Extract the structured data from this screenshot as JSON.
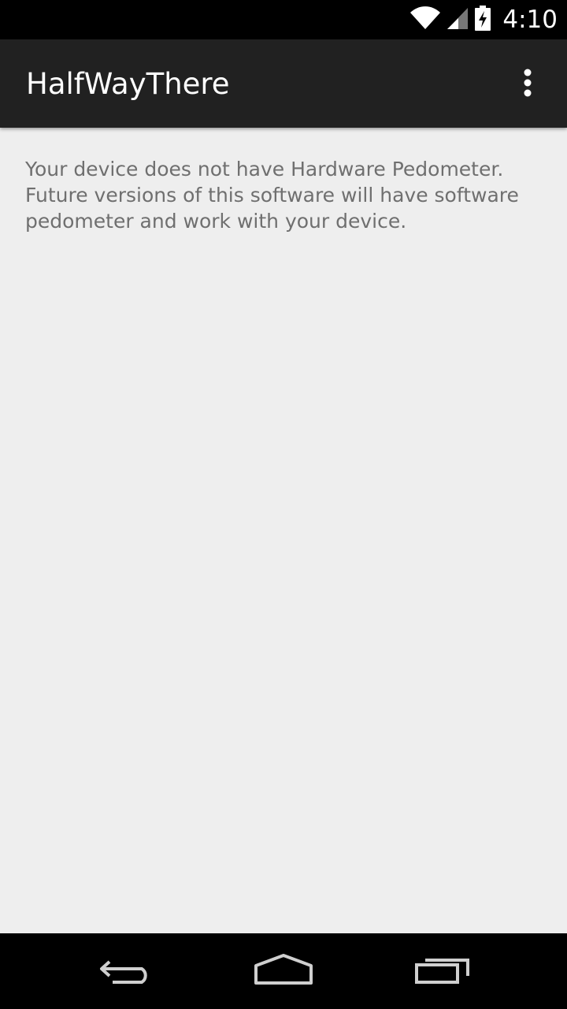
{
  "status_bar": {
    "time": "4:10",
    "icons": [
      "wifi-icon",
      "signal-icon",
      "battery-charging-icon"
    ]
  },
  "action_bar": {
    "title": "HalfWayThere",
    "overflow_icon": "overflow-menu-icon"
  },
  "main": {
    "message": "Your device does not have Hardware Pedometer. Future versions of this software will have software pedometer and work with your device."
  },
  "nav_bar": {
    "icons": [
      "back-icon",
      "home-icon",
      "recents-icon"
    ]
  },
  "colors": {
    "status_bar": "#000000",
    "action_bar": "#212121",
    "background": "#eeeeee",
    "text": "#6f6f6f",
    "nav_bar": "#000000"
  }
}
